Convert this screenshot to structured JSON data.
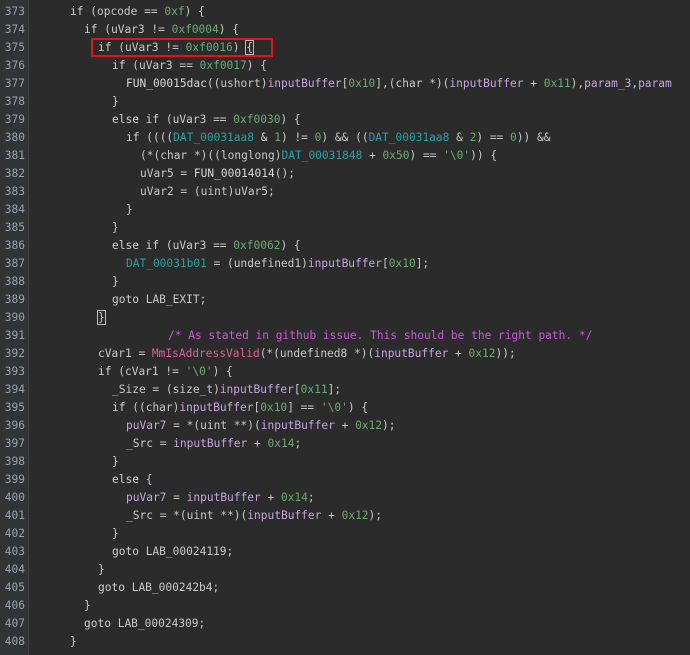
{
  "editor": {
    "lines": [
      {
        "num": "373",
        "indent": 1,
        "tokens": [
          [
            "kw",
            "if"
          ],
          [
            "op",
            " ("
          ],
          [
            "var",
            "opcode"
          ],
          [
            "op",
            " == "
          ],
          [
            "num",
            "0xf"
          ],
          [
            "op",
            ") {"
          ]
        ]
      },
      {
        "num": "374",
        "indent": 2,
        "tokens": [
          [
            "kw",
            "if"
          ],
          [
            "op",
            " ("
          ],
          [
            "var",
            "uVar3"
          ],
          [
            "op",
            " != "
          ],
          [
            "num",
            "0xf0004"
          ],
          [
            "op",
            ") {"
          ]
        ]
      },
      {
        "num": "375",
        "indent": 3,
        "tokens": [
          [
            "kw",
            "if"
          ],
          [
            "op",
            " ("
          ],
          [
            "var",
            "uVar3"
          ],
          [
            "op",
            " != "
          ],
          [
            "num",
            "0xf0016"
          ],
          [
            "op",
            ") "
          ],
          [
            "brace",
            "{"
          ]
        ]
      },
      {
        "num": "376",
        "indent": 4,
        "tokens": [
          [
            "kw",
            "if"
          ],
          [
            "op",
            " ("
          ],
          [
            "var",
            "uVar3"
          ],
          [
            "op",
            " == "
          ],
          [
            "num",
            "0xf0017"
          ],
          [
            "op",
            ") {"
          ]
        ]
      },
      {
        "num": "377",
        "indent": 5,
        "tokens": [
          [
            "fn",
            "FUN_00015dac"
          ],
          [
            "op",
            "(("
          ],
          [
            "type",
            "ushort"
          ],
          [
            "op",
            ")"
          ],
          [
            "buf",
            "inputBuffer"
          ],
          [
            "op",
            "["
          ],
          [
            "num",
            "0x10"
          ],
          [
            "op",
            "],("
          ],
          [
            "type",
            "char"
          ],
          [
            "op",
            " *)("
          ],
          [
            "buf",
            "inputBuffer"
          ],
          [
            "op",
            " + "
          ],
          [
            "num",
            "0x11"
          ],
          [
            "op",
            "),"
          ],
          [
            "buf",
            "param_3"
          ],
          [
            "op",
            ","
          ],
          [
            "buf",
            "param"
          ]
        ]
      },
      {
        "num": "378",
        "indent": 4,
        "tokens": [
          [
            "op",
            "}"
          ]
        ]
      },
      {
        "num": "379",
        "indent": 4,
        "tokens": [
          [
            "kw",
            "else if"
          ],
          [
            "op",
            " ("
          ],
          [
            "var",
            "uVar3"
          ],
          [
            "op",
            " == "
          ],
          [
            "num",
            "0xf0030"
          ],
          [
            "op",
            ") {"
          ]
        ]
      },
      {
        "num": "380",
        "indent": 5,
        "tokens": [
          [
            "kw",
            "if"
          ],
          [
            "op",
            " (((("
          ],
          [
            "dat",
            "DAT_00031aa8"
          ],
          [
            "op",
            " & "
          ],
          [
            "num",
            "1"
          ],
          [
            "op",
            ") != "
          ],
          [
            "num",
            "0"
          ],
          [
            "op",
            ") && (("
          ],
          [
            "dat",
            "DAT_00031aa8"
          ],
          [
            "op",
            " & "
          ],
          [
            "num",
            "2"
          ],
          [
            "op",
            ") == "
          ],
          [
            "num",
            "0"
          ],
          [
            "op",
            ")) &&"
          ]
        ]
      },
      {
        "num": "381",
        "indent": 6,
        "tokens": [
          [
            "op",
            "(*("
          ],
          [
            "type",
            "char"
          ],
          [
            "op",
            " *)(("
          ],
          [
            "type",
            "longlong"
          ],
          [
            "op",
            ")"
          ],
          [
            "dat",
            "DAT_00031848"
          ],
          [
            "op",
            " + "
          ],
          [
            "num",
            "0x50"
          ],
          [
            "op",
            ") == "
          ],
          [
            "str",
            "'\\0'"
          ],
          [
            "op",
            ")) {"
          ]
        ]
      },
      {
        "num": "382",
        "indent": 6,
        "tokens": [
          [
            "var",
            "uVar5"
          ],
          [
            "op",
            " = "
          ],
          [
            "fn",
            "FUN_00014014"
          ],
          [
            "op",
            "();"
          ]
        ]
      },
      {
        "num": "383",
        "indent": 6,
        "tokens": [
          [
            "var",
            "uVar2"
          ],
          [
            "op",
            " = ("
          ],
          [
            "type",
            "uint"
          ],
          [
            "op",
            ")"
          ],
          [
            "var",
            "uVar5"
          ],
          [
            "op",
            ";"
          ]
        ]
      },
      {
        "num": "384",
        "indent": 5,
        "tokens": [
          [
            "op",
            "}"
          ]
        ]
      },
      {
        "num": "385",
        "indent": 4,
        "tokens": [
          [
            "op",
            "}"
          ]
        ]
      },
      {
        "num": "386",
        "indent": 4,
        "tokens": [
          [
            "kw",
            "else if"
          ],
          [
            "op",
            " ("
          ],
          [
            "var",
            "uVar3"
          ],
          [
            "op",
            " == "
          ],
          [
            "num",
            "0xf0062"
          ],
          [
            "op",
            ") {"
          ]
        ]
      },
      {
        "num": "387",
        "indent": 5,
        "tokens": [
          [
            "dat",
            "DAT_00031b01"
          ],
          [
            "op",
            " = ("
          ],
          [
            "type",
            "undefined1"
          ],
          [
            "op",
            ")"
          ],
          [
            "buf",
            "inputBuffer"
          ],
          [
            "op",
            "["
          ],
          [
            "num",
            "0x10"
          ],
          [
            "op",
            "];"
          ]
        ]
      },
      {
        "num": "388",
        "indent": 4,
        "tokens": [
          [
            "op",
            "}"
          ]
        ]
      },
      {
        "num": "389",
        "indent": 4,
        "tokens": [
          [
            "kw",
            "goto"
          ],
          [
            "op",
            " "
          ],
          [
            "label",
            "LAB_EXIT"
          ],
          [
            "op",
            ";"
          ]
        ]
      },
      {
        "num": "390",
        "indent": 3,
        "tokens": [
          [
            "brace",
            "}"
          ]
        ]
      },
      {
        "num": "391",
        "indent": 7,
        "tokens": [
          [
            "cmt",
            "/* As stated in github issue. This should be the right path. */"
          ]
        ]
      },
      {
        "num": "392",
        "indent": 3,
        "tokens": [
          [
            "var",
            "cVar1"
          ],
          [
            "op",
            " = "
          ],
          [
            "api",
            "MmIsAddressValid"
          ],
          [
            "op",
            "(*("
          ],
          [
            "type",
            "undefined8"
          ],
          [
            "op",
            " *)("
          ],
          [
            "buf",
            "inputBuffer"
          ],
          [
            "op",
            " + "
          ],
          [
            "num",
            "0x12"
          ],
          [
            "op",
            "));"
          ]
        ]
      },
      {
        "num": "393",
        "indent": 3,
        "tokens": [
          [
            "kw",
            "if"
          ],
          [
            "op",
            " ("
          ],
          [
            "var",
            "cVar1"
          ],
          [
            "op",
            " != "
          ],
          [
            "str",
            "'\\0'"
          ],
          [
            "op",
            ") {"
          ]
        ]
      },
      {
        "num": "394",
        "indent": 4,
        "tokens": [
          [
            "var",
            "_Size"
          ],
          [
            "op",
            " = ("
          ],
          [
            "type",
            "size_t"
          ],
          [
            "op",
            ")"
          ],
          [
            "buf",
            "inputBuffer"
          ],
          [
            "op",
            "["
          ],
          [
            "num",
            "0x11"
          ],
          [
            "op",
            "];"
          ]
        ]
      },
      {
        "num": "395",
        "indent": 4,
        "tokens": [
          [
            "kw",
            "if"
          ],
          [
            "op",
            " (("
          ],
          [
            "type",
            "char"
          ],
          [
            "op",
            ")"
          ],
          [
            "buf",
            "inputBuffer"
          ],
          [
            "op",
            "["
          ],
          [
            "num",
            "0x10"
          ],
          [
            "op",
            "] == "
          ],
          [
            "str",
            "'\\0'"
          ],
          [
            "op",
            ") {"
          ]
        ]
      },
      {
        "num": "396",
        "indent": 5,
        "tokens": [
          [
            "buf",
            "puVar7"
          ],
          [
            "op",
            " = *("
          ],
          [
            "type",
            "uint"
          ],
          [
            "op",
            " **)("
          ],
          [
            "buf",
            "inputBuffer"
          ],
          [
            "op",
            " + "
          ],
          [
            "num",
            "0x12"
          ],
          [
            "op",
            ");"
          ]
        ]
      },
      {
        "num": "397",
        "indent": 5,
        "tokens": [
          [
            "var",
            "_Src"
          ],
          [
            "op",
            " = "
          ],
          [
            "buf",
            "inputBuffer"
          ],
          [
            "op",
            " + "
          ],
          [
            "num",
            "0x14"
          ],
          [
            "op",
            ";"
          ]
        ]
      },
      {
        "num": "398",
        "indent": 4,
        "tokens": [
          [
            "op",
            "}"
          ]
        ]
      },
      {
        "num": "399",
        "indent": 4,
        "tokens": [
          [
            "kw",
            "else"
          ],
          [
            "op",
            " {"
          ]
        ]
      },
      {
        "num": "400",
        "indent": 5,
        "tokens": [
          [
            "buf",
            "puVar7"
          ],
          [
            "op",
            " = "
          ],
          [
            "buf",
            "inputBuffer"
          ],
          [
            "op",
            " + "
          ],
          [
            "num",
            "0x14"
          ],
          [
            "op",
            ";"
          ]
        ]
      },
      {
        "num": "401",
        "indent": 5,
        "tokens": [
          [
            "var",
            "_Src"
          ],
          [
            "op",
            " = *("
          ],
          [
            "type",
            "uint"
          ],
          [
            "op",
            " **)("
          ],
          [
            "buf",
            "inputBuffer"
          ],
          [
            "op",
            " + "
          ],
          [
            "num",
            "0x12"
          ],
          [
            "op",
            ");"
          ]
        ]
      },
      {
        "num": "402",
        "indent": 4,
        "tokens": [
          [
            "op",
            "}"
          ]
        ]
      },
      {
        "num": "403",
        "indent": 4,
        "tokens": [
          [
            "kw",
            "goto"
          ],
          [
            "op",
            " "
          ],
          [
            "label",
            "LAB_00024119"
          ],
          [
            "op",
            ";"
          ]
        ]
      },
      {
        "num": "404",
        "indent": 3,
        "tokens": [
          [
            "op",
            "}"
          ]
        ]
      },
      {
        "num": "405",
        "indent": 3,
        "tokens": [
          [
            "kw",
            "goto"
          ],
          [
            "op",
            " "
          ],
          [
            "label",
            "LAB_000242b4"
          ],
          [
            "op",
            ";"
          ]
        ]
      },
      {
        "num": "406",
        "indent": 2,
        "tokens": [
          [
            "op",
            "}"
          ]
        ]
      },
      {
        "num": "407",
        "indent": 2,
        "tokens": [
          [
            "kw",
            "goto"
          ],
          [
            "op",
            " "
          ],
          [
            "label",
            "LAB_00024309"
          ],
          [
            "op",
            ";"
          ]
        ]
      },
      {
        "num": "408",
        "indent": 1,
        "tokens": [
          [
            "op",
            "}"
          ]
        ]
      }
    ]
  },
  "colors": {
    "background": "#2b2b2b",
    "highlight_box": "#e0141e",
    "number": "#6aab73",
    "data_symbol": "#27a2a2",
    "buffer_symbol": "#c6a5e0",
    "api_call": "#e0609c",
    "comment": "#cc5bd9"
  }
}
